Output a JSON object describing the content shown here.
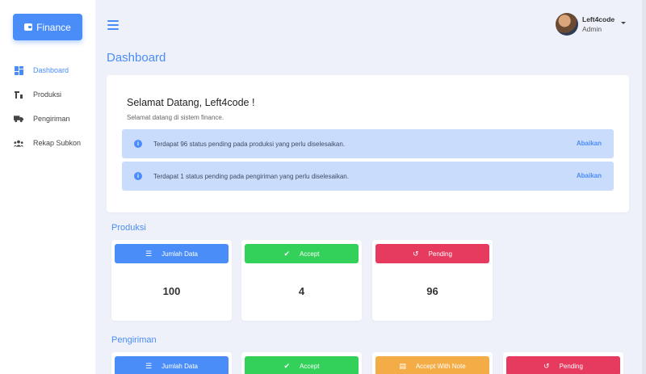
{
  "app": {
    "brand": "Finance"
  },
  "sidebar": {
    "items": [
      {
        "label": "Dashboard",
        "icon": "dashboard-icon"
      },
      {
        "label": "Produksi",
        "icon": "factory-icon"
      },
      {
        "label": "Pengiriman",
        "icon": "truck-icon"
      },
      {
        "label": "Rekap Subkon",
        "icon": "users-icon"
      }
    ]
  },
  "user": {
    "name": "Left4code",
    "role": "Admin"
  },
  "page": {
    "title": "Dashboard"
  },
  "welcome": {
    "title": "Selamat Datang, Left4code !",
    "subtitle": "Selamat datang di sistem finance.",
    "alerts": [
      {
        "text": "Terdapat 96 status pending pada produksi yang perlu diselesaikan.",
        "action": "Abaikan"
      },
      {
        "text": "Terdapat 1 status pending pada pengiriman yang perlu diselesaikan.",
        "action": "Abaikan"
      }
    ]
  },
  "produksi": {
    "title": "Produksi",
    "cards": [
      {
        "label": "Jumlah Data",
        "value": "100",
        "color": "#4a8df8",
        "icon": "list-icon"
      },
      {
        "label": "Accept",
        "value": "4",
        "color": "#33d05a",
        "icon": "check-icon"
      },
      {
        "label": "Pending",
        "value": "96",
        "color": "#e63b5f",
        "icon": "history-icon"
      }
    ]
  },
  "pengiriman": {
    "title": "Pengiriman",
    "cards": [
      {
        "label": "Jumlah Data",
        "color": "#4a8df8",
        "icon": "list-icon"
      },
      {
        "label": "Accept",
        "color": "#33d05a",
        "icon": "check-icon"
      },
      {
        "label": "Accept With Note",
        "color": "#f4ad46",
        "icon": "note-icon"
      },
      {
        "label": "Pending",
        "color": "#e63b5f",
        "icon": "history-icon"
      }
    ]
  }
}
